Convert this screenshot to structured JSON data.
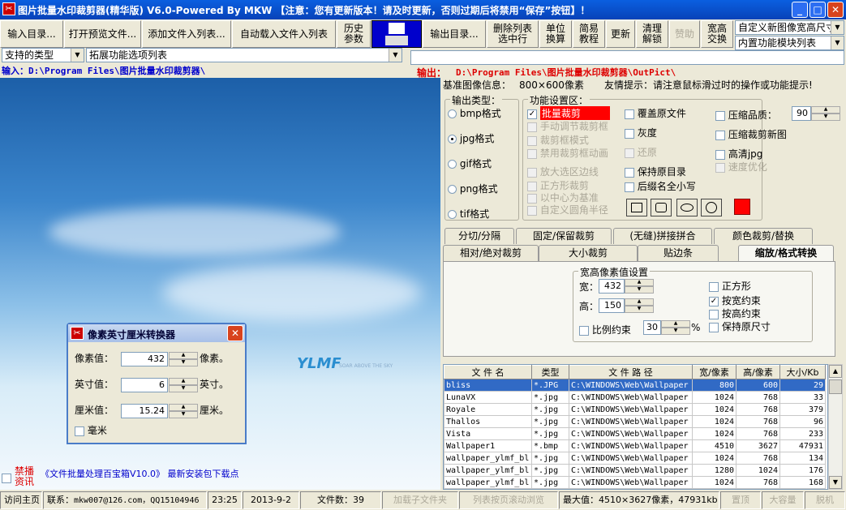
{
  "title": "图片批量水印裁剪器(精华版) V6.0-Powered By MKW 【注意：您有更新版本！请及时更新，否则过期后将禁用“保存”按钮】！",
  "toolbar": {
    "input_dir": "输入目录...",
    "open_preview": "打开预览文件...",
    "add_file": "添加文件入列表...",
    "auto_load": "自动载入文件入列表",
    "history": "历史\n参数",
    "output_dir": "输出目录...",
    "delete_list": "删除列表\n选中行",
    "unit": "单位\n换算",
    "simple": "简易\n教程",
    "update": "更新",
    "clear": "清理\n解锁",
    "donate": "赞助",
    "wh_swap": "宽高\n交换",
    "custom_size": "自定义新图像宽高尺寸",
    "module_list": "内置功能模块列表"
  },
  "filters": {
    "type": "支持的类型",
    "ext": "拓展功能选项列表"
  },
  "paths": {
    "input_label": "输入：",
    "input_path": "D:\\Program Files\\图片批量水印裁剪器\\",
    "output_label": "输出：",
    "output_path": "D:\\Program Files\\图片批量水印裁剪器\\OutPict\\"
  },
  "info": {
    "base_label": "基准图像信息：",
    "base_value": "800×600像素",
    "hint": "友情提示：请注意鼠标滑过时的操作或功能提示!"
  },
  "output_type": {
    "legend": "输出类型：",
    "options": [
      "bmp格式",
      "jpg格式",
      "gif格式",
      "png格式",
      "tif格式"
    ],
    "selected": "jpg格式"
  },
  "func": {
    "legend": "功能设置区：",
    "batch_crop": "批量裁剪",
    "manual": "手动调节裁剪框",
    "cropbox": "裁剪框模式",
    "noanim": "禁用裁剪框动画",
    "magnify": "放大选区边线",
    "square": "正方形裁剪",
    "center": "以中心为基准",
    "radius": "自定义圆角半径",
    "overwrite": "覆盖原文件",
    "gray": "灰度",
    "restore": "还原",
    "keep_dir": "保持原目录",
    "lower_ext": "后缀名全小写",
    "quality": "压缩品质：",
    "quality_value": "90",
    "compress_new": "压缩裁剪新图",
    "hq_jpg": "高清jpg",
    "speed": "速度优化"
  },
  "tabs": {
    "row1": [
      "分切/分隔",
      "固定/保留裁剪",
      "(无缝)拼接拼合",
      "颜色裁剪/替换"
    ],
    "row2": [
      "相对/绝对裁剪",
      "大小裁剪",
      "贴边条",
      "缩放/格式转换"
    ],
    "active": "缩放/格式转换"
  },
  "resize": {
    "legend": "宽高像素值设置",
    "width_label": "宽：",
    "width": "432",
    "height_label": "高：",
    "height": "150",
    "ratio_label": "比例约束",
    "ratio": "30",
    "percent": "%",
    "square": "正方形",
    "by_width": "按宽约束",
    "by_height": "按高约束",
    "keep_size": "保持原尺寸"
  },
  "converter": {
    "title": "像素英寸厘米转换器",
    "px_label": "像素值：",
    "px": "432",
    "px_unit": "像素。",
    "in_label": "英寸值：",
    "in": "6",
    "in_unit": "英寸。",
    "cm_label": "厘米值：",
    "cm": "15.24",
    "cm_unit": "厘米。",
    "mm_label": "毫米"
  },
  "promo": {
    "ban": "禁播\n资讯",
    "text": "《文件批量处理百宝箱V10.0》 最新安装包下载点"
  },
  "file_table": {
    "headers": [
      "文 件 名",
      "类型",
      "文 件 路 径",
      "宽/像素",
      "高/像素",
      "大小/Kb"
    ],
    "rows": [
      [
        "bliss",
        "*.JPG",
        "C:\\WINDOWS\\Web\\Wallpaper",
        "800",
        "600",
        "29"
      ],
      [
        "LunaVX",
        "*.jpg",
        "C:\\WINDOWS\\Web\\Wallpaper",
        "1024",
        "768",
        "33"
      ],
      [
        "Royale",
        "*.jpg",
        "C:\\WINDOWS\\Web\\Wallpaper",
        "1024",
        "768",
        "379"
      ],
      [
        "Thallos",
        "*.jpg",
        "C:\\WINDOWS\\Web\\Wallpaper",
        "1024",
        "768",
        "96"
      ],
      [
        "Vista",
        "*.jpg",
        "C:\\WINDOWS\\Web\\Wallpaper",
        "1024",
        "768",
        "233"
      ],
      [
        "Wallpaper1",
        "*.bmp",
        "C:\\WINDOWS\\Web\\Wallpaper",
        "4510",
        "3627",
        "47931"
      ],
      [
        "wallpaper_ylmf_bl",
        "*.jpg",
        "C:\\WINDOWS\\Web\\Wallpaper",
        "1024",
        "768",
        "134"
      ],
      [
        "wallpaper_ylmf_bl",
        "*.jpg",
        "C:\\WINDOWS\\Web\\Wallpaper",
        "1280",
        "1024",
        "176"
      ],
      [
        "wallpaper_ylmf_bl",
        "*.jpg",
        "C:\\WINDOWS\\Web\\Wallpaper",
        "1024",
        "768",
        "168"
      ]
    ]
  },
  "statusbar": {
    "home": "访问主页",
    "contact": "联系：",
    "email": "mkw007@126.com，QQ15104946",
    "time": "23:25",
    "date": "2013-9-2",
    "count": "文件数：39",
    "subfolder": "加载子文件夹",
    "scroll": "列表按页滚动浏览",
    "max": "最大值：4510×3627像素，47931kb",
    "top": "置顶",
    "large": "大容量",
    "offline": "脱机"
  },
  "logo_text": "YLMF",
  "logo_tag": "SOAR ABOVE THE SKY",
  "colors": {
    "accent": "#0a5fe0",
    "red": "#ff0000",
    "select": "#316ac5"
  }
}
